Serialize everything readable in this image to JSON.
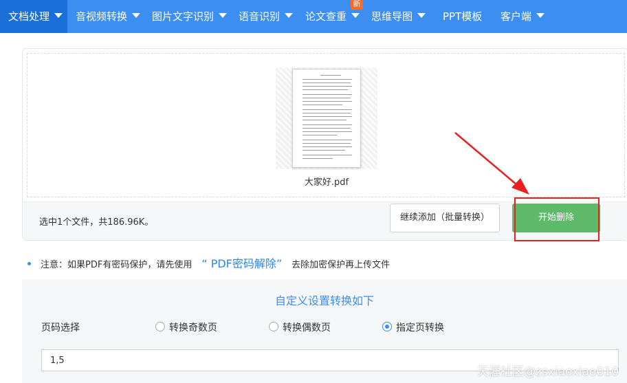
{
  "nav": {
    "items": [
      {
        "label": "文档处理"
      },
      {
        "label": "音视频转换"
      },
      {
        "label": "图片文字识别"
      },
      {
        "label": "语音识别"
      },
      {
        "label": "论文查重"
      },
      {
        "label": "思维导图"
      },
      {
        "label": "PPT模板"
      },
      {
        "label": "客户端"
      }
    ],
    "new_badge": "新"
  },
  "upload": {
    "file_name": "大家好.pdf",
    "file_count_text": "选中1个文件，共186.96K。",
    "continue_button": "继续添加（批量转换）",
    "start_button": "开始删除"
  },
  "note": {
    "prefix": "注意：如果PDF有密码保护，请先使用",
    "link": "“ PDF密码解除”",
    "suffix": "去除加密保护再上传文件"
  },
  "settings": {
    "title": "自定义设置转换如下",
    "page_select_label": "页码选择",
    "options": [
      {
        "label": "转换奇数页",
        "selected": false
      },
      {
        "label": "转换偶数页",
        "selected": false
      },
      {
        "label": "指定页转换",
        "selected": true
      }
    ],
    "page_input_value": "1,5"
  },
  "watermark": "天涯社区@zsxiaoxiao010",
  "colors": {
    "nav_bg": "#3c8ef0",
    "nav_active": "#1a6fd9",
    "start_button": "#5cba68",
    "annotation_red": "#e8201f",
    "link_blue": "#2f85e6"
  }
}
